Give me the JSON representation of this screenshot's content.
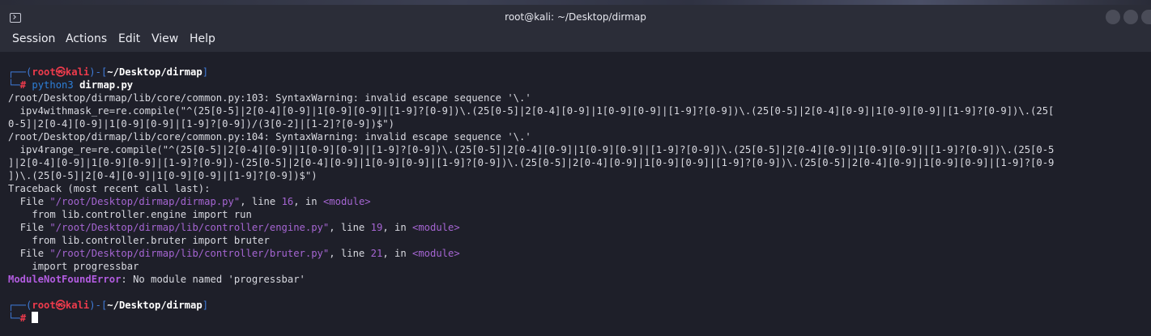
{
  "window": {
    "title": "root@kali: ~/Desktop/dirmap"
  },
  "menu": [
    "Session",
    "Actions",
    "Edit",
    "View",
    "Help"
  ],
  "prompt": {
    "user": "root",
    "at": "㉿",
    "host": "kali",
    "path": "~/Desktop/dirmap",
    "hash": "#"
  },
  "command": {
    "bin": "python3",
    "arg": "dirmap.py"
  },
  "output": [
    "/root/Desktop/dirmap/lib/core/common.py:103: SyntaxWarning: invalid escape sequence '\\.'",
    "  ipv4withmask_re=re.compile(\"^(25[0-5]|2[0-4][0-9]|1[0-9][0-9]|[1-9]?[0-9])\\.(25[0-5]|2[0-4][0-9]|1[0-9][0-9]|[1-9]?[0-9])\\.(25[0-5]|2[0-4][0-9]|1[0-9][0-9]|[1-9]?[0-9])\\.(25[",
    "0-5]|2[0-4][0-9]|1[0-9][0-9]|[1-9]?[0-9])/(3[0-2]|[1-2]?[0-9])$\")",
    "/root/Desktop/dirmap/lib/core/common.py:104: SyntaxWarning: invalid escape sequence '\\.'",
    "  ipv4range_re=re.compile(\"^(25[0-5]|2[0-4][0-9]|1[0-9][0-9]|[1-9]?[0-9])\\.(25[0-5]|2[0-4][0-9]|1[0-9][0-9]|[1-9]?[0-9])\\.(25[0-5]|2[0-4][0-9]|1[0-9][0-9]|[1-9]?[0-9])\\.(25[0-5",
    "]|2[0-4][0-9]|1[0-9][0-9]|[1-9]?[0-9])-(25[0-5]|2[0-4][0-9]|1[0-9][0-9]|[1-9]?[0-9])\\.(25[0-5]|2[0-4][0-9]|1[0-9][0-9]|[1-9]?[0-9])\\.(25[0-5]|2[0-4][0-9]|1[0-9][0-9]|[1-9]?[0-9",
    "])\\.(25[0-5]|2[0-4][0-9]|1[0-9][0-9]|[1-9]?[0-9])$\")",
    "Traceback (most recent call last):"
  ],
  "traceback": [
    {
      "file": "\"/root/Desktop/dirmap/dirmap.py\"",
      "line": "16",
      "code": "from lib.controller.engine import run"
    },
    {
      "file": "\"/root/Desktop/dirmap/lib/controller/engine.py\"",
      "line": "19",
      "code": "from lib.controller.bruter import bruter"
    },
    {
      "file": "\"/root/Desktop/dirmap/lib/controller/bruter.py\"",
      "line": "21",
      "code": "import progressbar"
    }
  ],
  "tb_labels": {
    "file": "File ",
    "line": ", line ",
    "in": ", in ",
    "module": "<module>"
  },
  "error": {
    "type": "ModuleNotFoundError",
    "message": ": No module named 'progressbar'"
  },
  "colors": {
    "prompt_frame": "#3f7bd8",
    "user": "#ee3b4c",
    "module": "#a565d2",
    "error": "#b25ce0"
  }
}
